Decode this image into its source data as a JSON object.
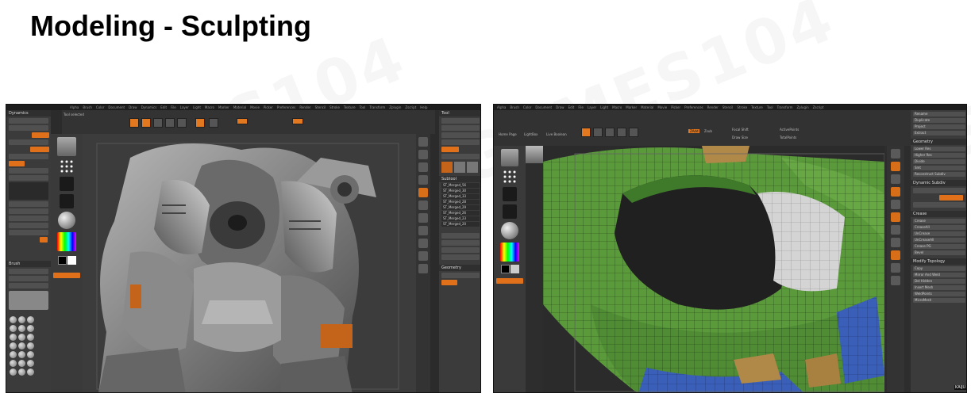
{
  "slide": {
    "title": "Modeling - Sculpting",
    "watermark": "GAMES104"
  },
  "left_screenshot": {
    "menu_items": [
      "Alpha",
      "Brush",
      "Color",
      "Document",
      "Draw",
      "Dynamics",
      "Edit",
      "File",
      "Layer",
      "Light",
      "Macro",
      "Marker",
      "Material",
      "Movie",
      "Picker",
      "Preferences",
      "Render",
      "Stencil",
      "Stroke",
      "Texture",
      "Tool",
      "Transform",
      "Zplugin",
      "Zscript",
      "Help"
    ],
    "left_panel": {
      "header": "Dynamics",
      "items": [
        "Simulation Iterations 100",
        "Strength",
        "Ctrl Masked",
        "Inflate Amount",
        "Self Collision",
        "Gravity",
        "Gravity Strength",
        "Collision",
        "Simulation"
      ]
    },
    "brush_panel": {
      "header": "Brush",
      "items": [
        "Load Brush",
        "Save As",
        "Clone",
        "Lightbox > Brushes"
      ]
    },
    "right_panel": {
      "header": "Tool",
      "items": [
        "Load Tool",
        "Save As",
        "Copy Tool",
        "Paste Tool",
        "Import",
        "Export",
        "Clone",
        "Make PolyMesh3D",
        "GoZ",
        "All",
        "Visible",
        "R",
        "Lightbox > Tools"
      ],
      "subtool_header": "Subtool",
      "subtools": [
        "ST_Merged_56",
        "ST_Merged_30",
        "ST_Merged_33",
        "ST_Merged_28",
        "ST_Merged_29",
        "ST_Merged_26",
        "ST_Merged_23",
        "ST_Merged_20"
      ],
      "geometry_header": "Geometry"
    },
    "tool_label": "Tool selected"
  },
  "right_screenshot": {
    "menu_items": [
      "Alpha",
      "Brush",
      "Color",
      "Document",
      "Draw",
      "Edit",
      "File",
      "Layer",
      "Light",
      "Macro",
      "Marker",
      "Material",
      "Movie",
      "Picker",
      "Preferences",
      "Render",
      "Stencil",
      "Stroke",
      "Texture",
      "Tool",
      "Transform",
      "Zplugin",
      "Zscript"
    ],
    "toolbar_left": [
      "Home Page",
      "LightBox",
      "Live Boolean"
    ],
    "labels": [
      "ZAdd",
      "Zsub",
      "Focal Shift",
      "Draw Size",
      "ActivePoints",
      "TotalPoints"
    ],
    "right_panel": {
      "items": [
        "Rename",
        "Duplicate",
        "Project",
        "Extract"
      ],
      "geometry_header": "Geometry",
      "geometry_items": [
        "Lower Res",
        "Higher Res",
        "Divide",
        "Smt",
        "Reconstruct Subdiv"
      ],
      "dynamic_subdiv_header": "Dynamic Subdiv",
      "crease_header": "Crease",
      "crease_items": [
        "Crease",
        "CreaseAll",
        "UnCrease",
        "UnCreaseAll",
        "Crease PG",
        "Bevel"
      ],
      "modify_topology_header": "Modify Topology",
      "modify_items": [
        "Copy",
        "Mirror And Weld",
        "Del Hidden",
        "Insert Mesh",
        "WeldPoints",
        "MicroMesh"
      ]
    },
    "corner_badge": "KAIJU"
  },
  "colors": {
    "ui_dark": "#2b2b2b",
    "ui_panel": "#3b3b3b",
    "accent_orange": "#e2781f",
    "mesh_green": "#5a9a3a",
    "mesh_blue": "#3a5fb8",
    "mesh_white": "#d8d8d8",
    "mesh_tan": "#b08848"
  }
}
